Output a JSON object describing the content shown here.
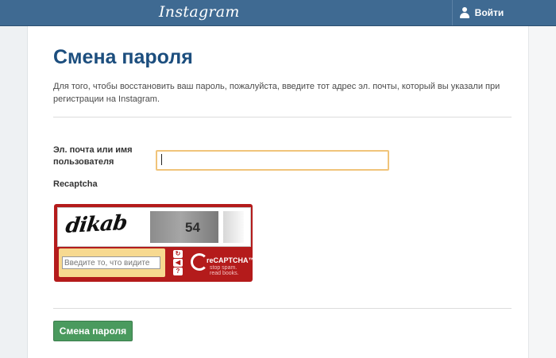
{
  "header": {
    "logo": "Instagram",
    "login_label": "Войти"
  },
  "page": {
    "title": "Смена пароля",
    "description": "Для того, чтобы восстановить ваш пароль, пожалуйста, введите тот адрес эл. почты, который вы указали при регистрации на Instagram."
  },
  "form": {
    "email_label": "Эл. почта или имя пользователя",
    "email_value": "",
    "recaptcha_label": "Recaptcha",
    "submit_label": "Смена пароля"
  },
  "captcha": {
    "word": "dikab",
    "number": "54",
    "input_placeholder": "Введите то, что видите",
    "brand": "reCAPTCHA™",
    "brand_sub_1": "stop spam.",
    "brand_sub_2": "read books.",
    "controls": [
      "refresh-icon",
      "audio-icon",
      "help-icon"
    ]
  },
  "colors": {
    "topbar": "#3f6a92",
    "title": "#1c4e7e",
    "captcha_red": "#b41b1b",
    "submit_green": "#4a9a5e",
    "input_focus": "#f0c47a"
  }
}
